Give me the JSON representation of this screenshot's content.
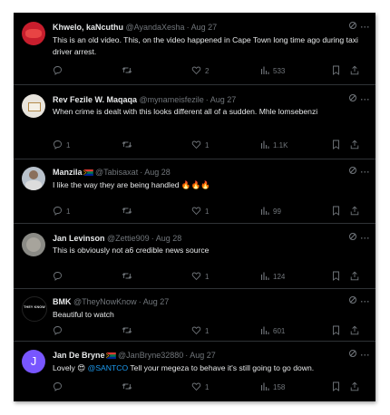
{
  "replies": [
    {
      "name": "Khwelo, kaNcuthu",
      "handle": "@AyandaXesha",
      "date": "Aug 27",
      "text": "This is an old video. This, on the video happened in Cape Town long time ago during taxi driver arrest.",
      "reply_count": "",
      "retweet_count": "",
      "like_count": "2",
      "view_count": "533",
      "avatar_color": "#c81e2d",
      "flag": false
    },
    {
      "name": "Rev Fezile W. Maqaqa",
      "handle": "@mynameisfezile",
      "date": "Aug 27",
      "text": "When crime is dealt with this looks different all of a sudden. Mhle lomsebenzi",
      "reply_count": "1",
      "retweet_count": "",
      "like_count": "1",
      "view_count": "1.1K",
      "avatar_color": "#e8e4dc",
      "flag": false
    },
    {
      "name": "Manzila",
      "handle": "@Tabisaxat",
      "date": "Aug 28",
      "text": "I like the way they are being handled",
      "emoji": "🔥🔥🔥",
      "reply_count": "1",
      "retweet_count": "",
      "like_count": "1",
      "view_count": "99",
      "avatar_color": "#b9c2cc",
      "flag": true
    },
    {
      "name": "Jan Levinson",
      "handle": "@Zettie909",
      "date": "Aug 28",
      "text": "This is obviously not a6 credible news source",
      "reply_count": "",
      "retweet_count": "",
      "like_count": "1",
      "view_count": "124",
      "avatar_color": "#8a8a85",
      "flag": false
    },
    {
      "name": "BMK",
      "handle": "@TheyNowKnow",
      "date": "Aug 27",
      "text": "Beautiful to watch",
      "avatar_text": "THEY KNOW",
      "reply_count": "",
      "retweet_count": "",
      "like_count": "1",
      "view_count": "601",
      "avatar_color": "#000000",
      "flag": false
    },
    {
      "name": "Jan De Bryne",
      "handle": "@JanBryne32880",
      "date": "Aug 27",
      "text_before": "Lovely",
      "emoji": "😍",
      "mention": "@SANTCO",
      "text_after": "Tell your megeza to behave it's still going to go down.",
      "avatar_letter": "J",
      "reply_count": "",
      "retweet_count": "",
      "like_count": "1",
      "view_count": "158",
      "avatar_color": "#7856ff",
      "flag": true
    }
  ],
  "icons": [
    "reply-icon",
    "retweet-icon",
    "like-icon",
    "views-icon",
    "bookmark-icon",
    "share-icon",
    "grok-icon",
    "more-icon"
  ],
  "colors": {
    "background": "#000000",
    "text": "#e7e9ea",
    "muted": "#71767b",
    "link": "#1d9bf0",
    "divider": "#2f3336"
  }
}
